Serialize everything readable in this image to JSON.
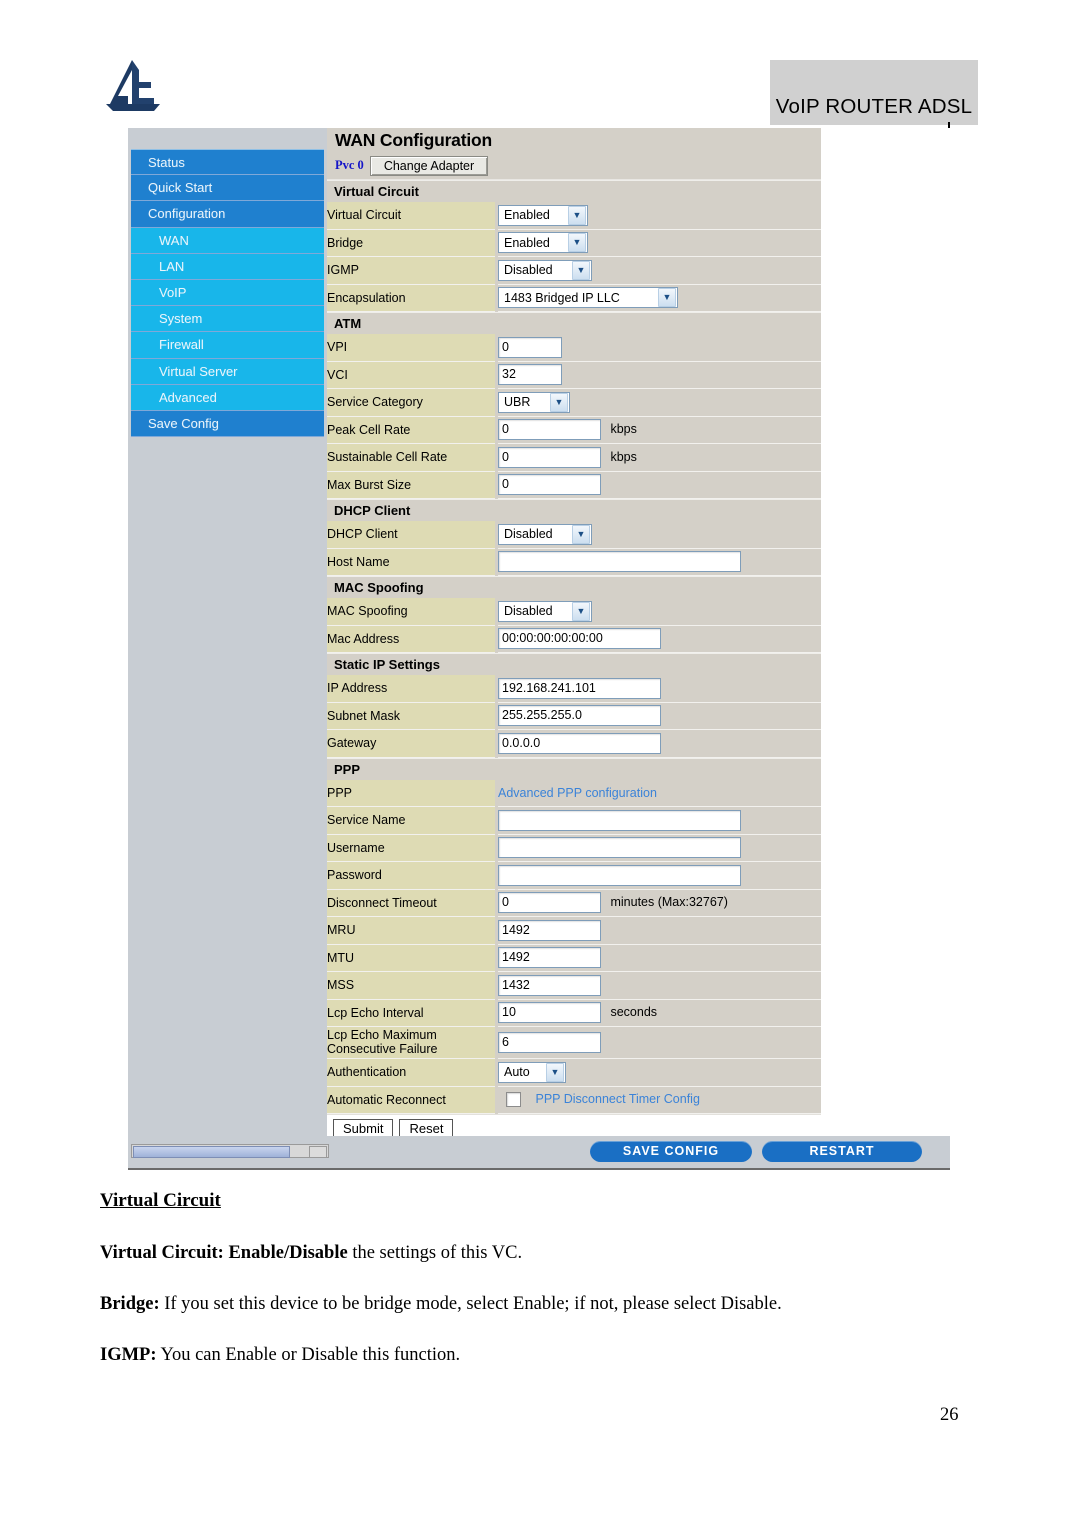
{
  "header": {
    "brand_text": "VoIP ROUTER ADSL",
    "logo_name": "billion-a-logo"
  },
  "router_ui": {
    "sidebar": {
      "items": [
        {
          "label": "Status",
          "level": 1,
          "active": false
        },
        {
          "label": "Quick Start",
          "level": 1,
          "active": false
        },
        {
          "label": "Configuration",
          "level": 1,
          "active": false
        },
        {
          "label": "WAN",
          "level": 2,
          "active": true
        },
        {
          "label": "LAN",
          "level": 2,
          "active": false
        },
        {
          "label": "VoIP",
          "level": 2,
          "active": false
        },
        {
          "label": "System",
          "level": 2,
          "active": false
        },
        {
          "label": "Firewall",
          "level": 2,
          "active": false
        },
        {
          "label": "Virtual Server",
          "level": 2,
          "active": false
        },
        {
          "label": "Advanced",
          "level": 2,
          "active": false
        },
        {
          "label": "Save Config",
          "level": 1,
          "active": false
        }
      ]
    },
    "page_title": "WAN Configuration",
    "pvc_label": "Pvc 0",
    "change_adapter_button": "Change Adapter",
    "sections": {
      "virtual_circuit": {
        "heading": "Virtual Circuit",
        "rows": [
          {
            "label": "Virtual Circuit",
            "value": "Enabled"
          },
          {
            "label": "Bridge",
            "value": "Enabled"
          },
          {
            "label": "IGMP",
            "value": "Disabled"
          },
          {
            "label": "Encapsulation",
            "value": "1483 Bridged IP LLC"
          }
        ]
      },
      "atm": {
        "heading": "ATM",
        "rows": [
          {
            "label": "VPI",
            "value": "0",
            "unit": ""
          },
          {
            "label": "VCI",
            "value": "32",
            "unit": ""
          },
          {
            "label": "Service Category",
            "value": "UBR",
            "unit": ""
          },
          {
            "label": "Peak Cell Rate",
            "value": "0",
            "unit": "kbps"
          },
          {
            "label": "Sustainable Cell Rate",
            "value": "0",
            "unit": "kbps"
          },
          {
            "label": "Max Burst Size",
            "value": "0",
            "unit": ""
          }
        ]
      },
      "dhcp_client": {
        "heading": "DHCP Client",
        "rows": [
          {
            "label": "DHCP Client",
            "value": "Disabled"
          },
          {
            "label": "Host Name",
            "value": ""
          }
        ]
      },
      "mac_spoofing": {
        "heading": "MAC Spoofing",
        "rows": [
          {
            "label": "MAC Spoofing",
            "value": "Disabled"
          },
          {
            "label": "Mac Address",
            "value": "00:00:00:00:00:00"
          }
        ]
      },
      "static_ip": {
        "heading": "Static IP Settings",
        "rows": [
          {
            "label": "IP Address",
            "value": "192.168.241.101"
          },
          {
            "label": "Subnet Mask",
            "value": "255.255.255.0"
          },
          {
            "label": "Gateway",
            "value": "0.0.0.0"
          }
        ]
      },
      "ppp": {
        "heading": "PPP",
        "advanced_link": "Advanced PPP configuration",
        "ppp_row_label": "PPP",
        "rows": [
          {
            "label": "Service Name",
            "value": "",
            "unit": ""
          },
          {
            "label": "Username",
            "value": "",
            "unit": ""
          },
          {
            "label": "Password",
            "value": "",
            "unit": ""
          },
          {
            "label": "Disconnect Timeout",
            "value": "0",
            "unit": "minutes (Max:32767)"
          },
          {
            "label": "MRU",
            "value": "1492",
            "unit": ""
          },
          {
            "label": "MTU",
            "value": "1492",
            "unit": ""
          },
          {
            "label": "MSS",
            "value": "1432",
            "unit": ""
          },
          {
            "label": "Lcp Echo Interval",
            "value": "10",
            "unit": "seconds"
          },
          {
            "label": "Lcp Echo Maximum Consecutive Failure",
            "value": "6",
            "unit": ""
          }
        ],
        "authentication": {
          "label": "Authentication",
          "value": "Auto"
        },
        "automatic_reconnect": {
          "label": "Automatic Reconnect",
          "checked": false,
          "link": "PPP Disconnect Timer Config"
        }
      }
    },
    "submit_button": "Submit",
    "reset_button": "Reset",
    "save_config_button": "SAVE CONFIG",
    "restart_button": "RESTART"
  },
  "document": {
    "section_heading": "Virtual Circuit",
    "paragraphs": [
      {
        "bold": "Virtual Circuit: Enable/Disable",
        "rest": " the settings of this VC."
      },
      {
        "bold": "Bridge:",
        "rest": " If you set this device to be bridge mode, select Enable; if not, please select Disable."
      },
      {
        "bold": "IGMP:",
        "rest": " You can Enable or Disable this function."
      }
    ],
    "page_number": "26"
  },
  "colors": {
    "sidebar_level1": "#1f80cf",
    "sidebar_level2": "#18b6ea",
    "label_cell": "#dedbb4",
    "panel_bg": "#d4d0c8",
    "pill_blue": "#1a6fc4",
    "link_blue": "#3b83d8",
    "pvc_blue": "#1414c8"
  }
}
